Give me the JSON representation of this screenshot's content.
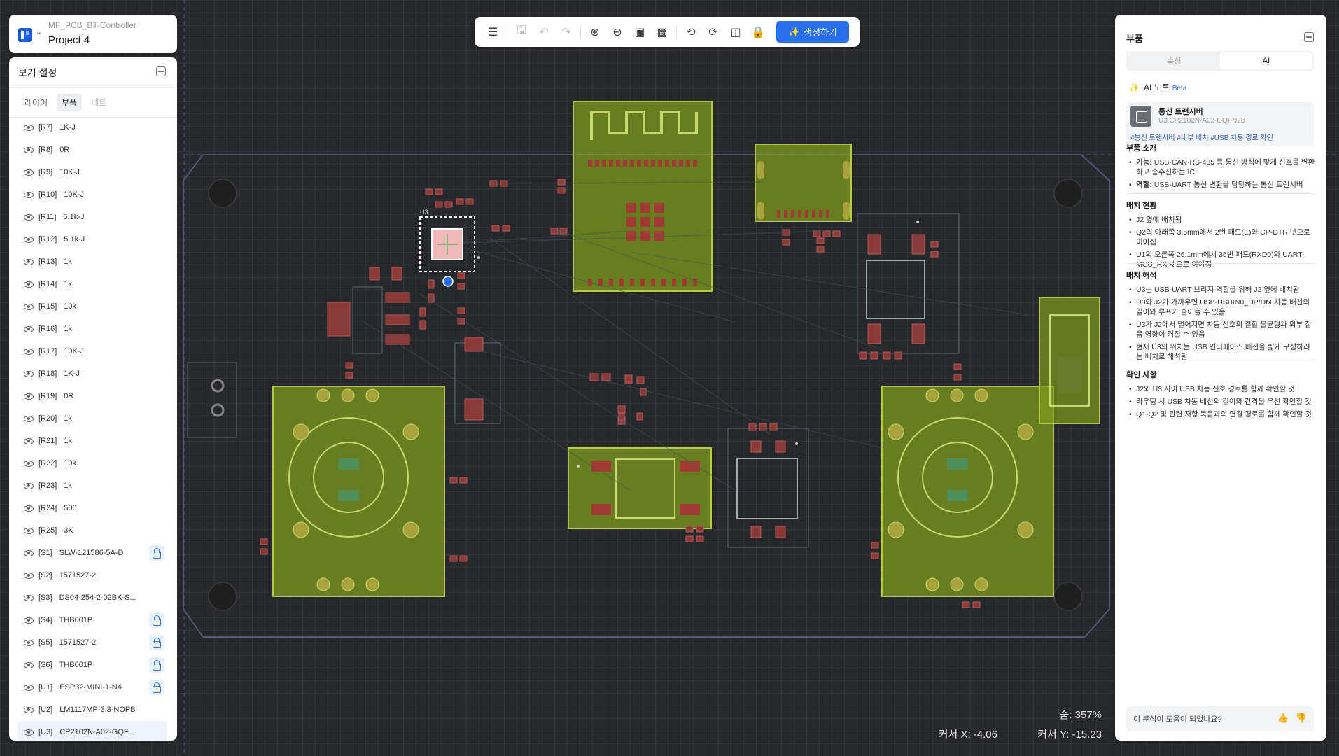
{
  "project": {
    "name": "MF_PCB_BT-Controller",
    "title": "Project 4"
  },
  "view_settings": {
    "title": "보기 설정",
    "tabs": [
      {
        "label": "레이어"
      },
      {
        "label": "부품"
      },
      {
        "label": "네트"
      }
    ],
    "components": [
      {
        "ref": "[R7]",
        "value": "1K-J",
        "locked": false
      },
      {
        "ref": "[R8]",
        "value": "0R",
        "locked": false
      },
      {
        "ref": "[R9]",
        "value": "10K-J",
        "locked": false
      },
      {
        "ref": "[R10]",
        "value": "10K-J",
        "locked": false
      },
      {
        "ref": "[R11]",
        "value": "5.1k-J",
        "locked": false
      },
      {
        "ref": "[R12]",
        "value": "5.1k-J",
        "locked": false
      },
      {
        "ref": "[R13]",
        "value": "1k",
        "locked": false
      },
      {
        "ref": "[R14]",
        "value": "1k",
        "locked": false
      },
      {
        "ref": "[R15]",
        "value": "10k",
        "locked": false
      },
      {
        "ref": "[R16]",
        "value": "1k",
        "locked": false
      },
      {
        "ref": "[R17]",
        "value": "10K-J",
        "locked": false
      },
      {
        "ref": "[R18]",
        "value": "1K-J",
        "locked": false
      },
      {
        "ref": "[R19]",
        "value": "0R",
        "locked": false
      },
      {
        "ref": "[R20]",
        "value": "1k",
        "locked": false
      },
      {
        "ref": "[R21]",
        "value": "1k",
        "locked": false
      },
      {
        "ref": "[R22]",
        "value": "10k",
        "locked": false
      },
      {
        "ref": "[R23]",
        "value": "1k",
        "locked": false
      },
      {
        "ref": "[R24]",
        "value": "500",
        "locked": false
      },
      {
        "ref": "[R25]",
        "value": "3K",
        "locked": false
      },
      {
        "ref": "[S1]",
        "value": "SLW-121586-5A-D",
        "locked": true
      },
      {
        "ref": "[S2]",
        "value": "1571527-2",
        "locked": false
      },
      {
        "ref": "[S3]",
        "value": "DS04-254-2-02BK-S...",
        "locked": false
      },
      {
        "ref": "[S4]",
        "value": "THB001P",
        "locked": true
      },
      {
        "ref": "[S5]",
        "value": "1571527-2",
        "locked": true
      },
      {
        "ref": "[S6]",
        "value": "THB001P",
        "locked": true
      },
      {
        "ref": "[U1]",
        "value": "ESP32-MINI-1-N4",
        "locked": true
      },
      {
        "ref": "[U2]",
        "value": "LM1117MP-3.3-NOPB",
        "locked": false
      },
      {
        "ref": "[U3]",
        "value": "CP2102N-A02-GQF...",
        "locked": false,
        "selected": true
      }
    ]
  },
  "toolbar": {
    "generate_label": "생성하기"
  },
  "right_panel": {
    "title": "부품",
    "tabs": [
      {
        "label": "속성"
      },
      {
        "label": "AI"
      }
    ],
    "ai_note_label": "AI 노트",
    "beta_label": "Beta",
    "component": {
      "name": "통신 트랜시버",
      "part": "U3  CP2102N-A02-GQFN28",
      "tags": "#통신 트랜시버  #내부 배치  #USB 차동 경로 확인"
    },
    "sections": [
      {
        "title": "부품 소개",
        "items": [
          {
            "bold": "기능:",
            "text": " USB·CAN·RS-485 등 통신 방식에 맞게 신호를 변환하고 송수신하는 IC"
          },
          {
            "bold": "역할:",
            "text": " USB-UART 통신 변환을 담당하는 통신 트랜시버"
          }
        ]
      },
      {
        "title": "배치 현황",
        "items": [
          {
            "bold": "",
            "text": "J2 옆에 배치됨"
          },
          {
            "bold": "",
            "text": "Q2의 아래쪽 3.5mm에서 2번 패드(E)와 CP-DTR 넷으로 이어짐"
          },
          {
            "bold": "",
            "text": "U1의 오른쪽 26.1mm에서 35번 패드(RXD0)와 UART-MCU_RX 넷으로 이어짐"
          }
        ]
      },
      {
        "title": "배치 해석",
        "items": [
          {
            "bold": "",
            "text": "U3는 USB-UART 브리지 역할을 위해 J2 옆에 배치됨"
          },
          {
            "bold": "",
            "text": "U3와 J2가 가까우면 USB-USBIN0_DP/DM 차동 배선의 길이와 루프가 줄어들 수 있음"
          },
          {
            "bold": "",
            "text": "U3가 J2에서 멀어지면 차동 신호의 결합 불균형과 외부 잡음 영향이 커질 수 있음"
          },
          {
            "bold": "",
            "text": "현재 U3의 위치는 USB 인터페이스 배선을 짧게 구성하려는 배치로 해석됨"
          }
        ]
      },
      {
        "title": "확인 사항",
        "items": [
          {
            "bold": "",
            "text": "J2와 U3 사이 USB 차동 신호 경로를 함께 확인할 것"
          },
          {
            "bold": "",
            "text": "라우팅 시 USB 차동 배선의 길이와 간격을 우선 확인할 것"
          },
          {
            "bold": "",
            "text": "Q1-Q2 및 관련 저항 묶음과의 연결 경로를 함께 확인할 것"
          }
        ]
      }
    ],
    "feedback_question": "이 분석이 도움이 되었나요?"
  },
  "status": {
    "zoom": "줌: 357%",
    "cursor_x": "커서 X: -4.06",
    "cursor_y": "커서 Y: -15.23"
  },
  "pcb": {
    "selected_label": "U3",
    "colors": {
      "copper": "#8aa61e",
      "pad": "#8c3b3b",
      "board_outline": "#5a5a8a",
      "selection": "#ffffff"
    }
  }
}
